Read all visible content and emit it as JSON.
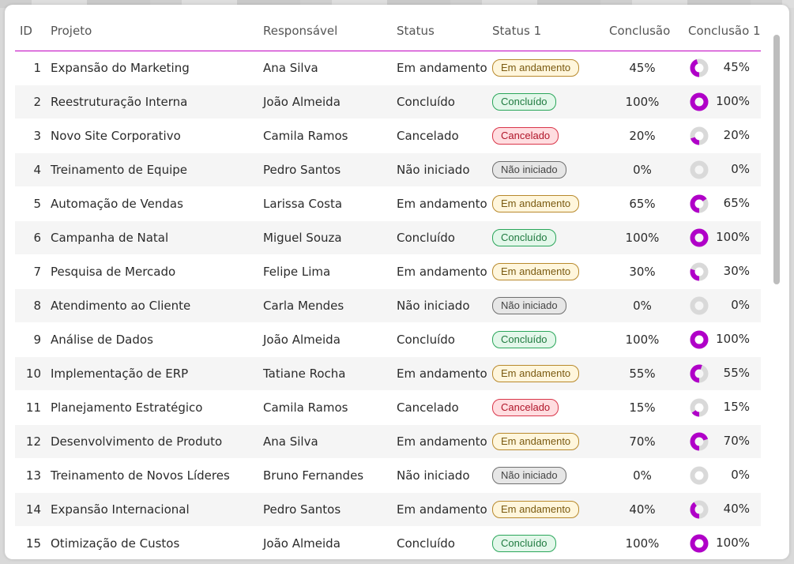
{
  "table": {
    "headers": {
      "id": "ID",
      "project": "Projeto",
      "owner": "Responsável",
      "status": "Status",
      "status1": "Status 1",
      "completion": "Conclusão",
      "completion1": "Conclusão 1"
    },
    "rows": [
      {
        "id": "1",
        "project": "Expansão do Marketing",
        "owner": "Ana Silva",
        "status": "Em andamento",
        "status1": "Em andamento",
        "completion": "45%",
        "completion1": "45%",
        "progress": 45
      },
      {
        "id": "2",
        "project": "Reestruturação Interna",
        "owner": "João Almeida",
        "status": "Concluído",
        "status1": "Concluído",
        "completion": "100%",
        "completion1": "100%",
        "progress": 100
      },
      {
        "id": "3",
        "project": "Novo Site Corporativo",
        "owner": "Camila Ramos",
        "status": "Cancelado",
        "status1": "Cancelado",
        "completion": "20%",
        "completion1": "20%",
        "progress": 20
      },
      {
        "id": "4",
        "project": "Treinamento de Equipe",
        "owner": "Pedro Santos",
        "status": "Não iniciado",
        "status1": "Não iniciado",
        "completion": "0%",
        "completion1": "0%",
        "progress": 0
      },
      {
        "id": "5",
        "project": "Automação de Vendas",
        "owner": "Larissa Costa",
        "status": "Em andamento",
        "status1": "Em andamento",
        "completion": "65%",
        "completion1": "65%",
        "progress": 65
      },
      {
        "id": "6",
        "project": "Campanha de Natal",
        "owner": "Miguel Souza",
        "status": "Concluído",
        "status1": "Concluído",
        "completion": "100%",
        "completion1": "100%",
        "progress": 100
      },
      {
        "id": "7",
        "project": "Pesquisa de Mercado",
        "owner": "Felipe Lima",
        "status": "Em andamento",
        "status1": "Em andamento",
        "completion": "30%",
        "completion1": "30%",
        "progress": 30
      },
      {
        "id": "8",
        "project": "Atendimento ao Cliente",
        "owner": "Carla Mendes",
        "status": "Não iniciado",
        "status1": "Não iniciado",
        "completion": "0%",
        "completion1": "0%",
        "progress": 0
      },
      {
        "id": "9",
        "project": "Análise de Dados",
        "owner": "João Almeida",
        "status": "Concluído",
        "status1": "Concluído",
        "completion": "100%",
        "completion1": "100%",
        "progress": 100
      },
      {
        "id": "10",
        "project": "Implementação de ERP",
        "owner": "Tatiane Rocha",
        "status": "Em andamento",
        "status1": "Em andamento",
        "completion": "55%",
        "completion1": "55%",
        "progress": 55
      },
      {
        "id": "11",
        "project": "Planejamento Estratégico",
        "owner": "Camila Ramos",
        "status": "Cancelado",
        "status1": "Cancelado",
        "completion": "15%",
        "completion1": "15%",
        "progress": 15
      },
      {
        "id": "12",
        "project": "Desenvolvimento de Produto",
        "owner": "Ana Silva",
        "status": "Em andamento",
        "status1": "Em andamento",
        "completion": "70%",
        "completion1": "70%",
        "progress": 70
      },
      {
        "id": "13",
        "project": "Treinamento de Novos Líderes",
        "owner": "Bruno Fernandes",
        "status": "Não iniciado",
        "status1": "Não iniciado",
        "completion": "0%",
        "completion1": "0%",
        "progress": 0
      },
      {
        "id": "14",
        "project": "Expansão Internacional",
        "owner": "Pedro Santos",
        "status": "Em andamento",
        "status1": "Em andamento",
        "completion": "40%",
        "completion1": "40%",
        "progress": 40
      },
      {
        "id": "15",
        "project": "Otimização de Custos",
        "owner": "João Almeida",
        "status": "Concluído",
        "status1": "Concluído",
        "completion": "100%",
        "completion1": "100%",
        "progress": 100
      }
    ]
  },
  "colors": {
    "accent": "#b000c8",
    "donut_track": "#d9d9d9",
    "header_rule": "#c000c0"
  },
  "badge_styles": {
    "Em andamento": "b-and",
    "Concluído": "b-con",
    "Cancelado": "b-can",
    "Não iniciado": "b-nao"
  }
}
